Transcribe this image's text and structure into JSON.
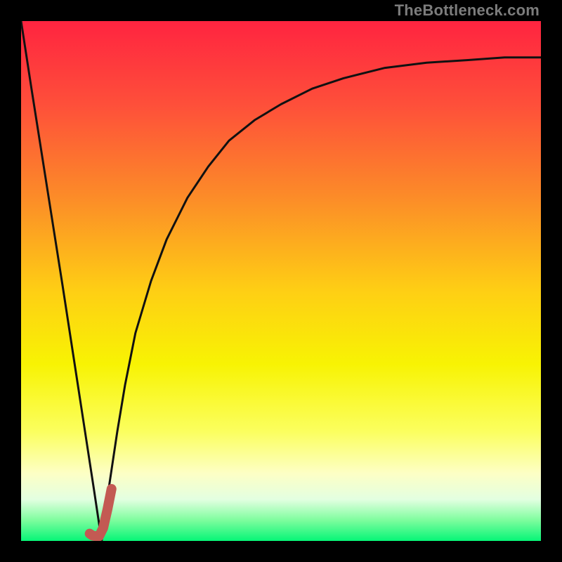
{
  "watermark": "TheBottleneck.com",
  "colors": {
    "frame": "#000000",
    "curve": "#111111",
    "marker": "#c35a53",
    "gradient_stops": [
      {
        "pct": 0,
        "color": "#ff2440"
      },
      {
        "pct": 16,
        "color": "#fe4f3a"
      },
      {
        "pct": 34,
        "color": "#fc8c28"
      },
      {
        "pct": 52,
        "color": "#fecf14"
      },
      {
        "pct": 66,
        "color": "#f8f303"
      },
      {
        "pct": 79,
        "color": "#fbff5f"
      },
      {
        "pct": 87,
        "color": "#fdffc5"
      },
      {
        "pct": 92,
        "color": "#e3ffe1"
      },
      {
        "pct": 96,
        "color": "#7efd9e"
      },
      {
        "pct": 100,
        "color": "#06f577"
      }
    ]
  },
  "chart_data": {
    "type": "line",
    "title": "",
    "xlabel": "",
    "ylabel": "",
    "xlim": [
      0,
      1
    ],
    "ylim": [
      0,
      1
    ],
    "series": [
      {
        "name": "bottleneck-curve",
        "x": [
          0.0,
          0.02,
          0.05,
          0.08,
          0.1,
          0.12,
          0.14,
          0.155,
          0.17,
          0.185,
          0.2,
          0.22,
          0.25,
          0.28,
          0.32,
          0.36,
          0.4,
          0.45,
          0.5,
          0.56,
          0.62,
          0.7,
          0.78,
          0.86,
          0.93,
          1.0
        ],
        "y": [
          1.0,
          0.87,
          0.68,
          0.49,
          0.36,
          0.23,
          0.1,
          0.0,
          0.11,
          0.21,
          0.3,
          0.4,
          0.5,
          0.58,
          0.66,
          0.72,
          0.77,
          0.81,
          0.84,
          0.87,
          0.89,
          0.91,
          0.92,
          0.925,
          0.93,
          0.93
        ]
      },
      {
        "name": "optimal-marker",
        "x": [
          0.132,
          0.138,
          0.145,
          0.15,
          0.158,
          0.166,
          0.174
        ],
        "y": [
          0.014,
          0.01,
          0.009,
          0.009,
          0.025,
          0.06,
          0.1
        ]
      }
    ],
    "optimal_x": 0.155
  }
}
